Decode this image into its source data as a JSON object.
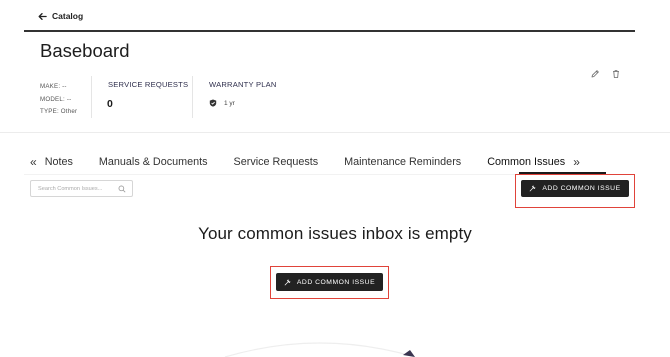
{
  "nav": {
    "back_label": "Catalog"
  },
  "asset": {
    "title": "Baseboard",
    "make": "MAKE: --",
    "model": "MODEL: --",
    "type": "TYPE: Other"
  },
  "service_requests": {
    "label": "SERVICE REQUESTS",
    "count": "0"
  },
  "warranty": {
    "label": "WARRANTY PLAN",
    "value": "1 yr"
  },
  "tabs": {
    "items": [
      {
        "label": "Notes"
      },
      {
        "label": "Manuals & Documents"
      },
      {
        "label": "Service Requests"
      },
      {
        "label": "Maintenance Reminders"
      },
      {
        "label": "Common Issues"
      }
    ],
    "active": "Common Issues"
  },
  "search": {
    "placeholder": "Search Common Issues..."
  },
  "actions": {
    "add_label": "ADD COMMON ISSUE"
  },
  "empty_state": {
    "message": "Your common issues inbox is empty",
    "button_label": "ADD COMMON ISSUE"
  },
  "colors": {
    "primary": "#222222",
    "highlight": "#e0433a"
  },
  "icons": [
    "arrow-left-icon",
    "pencil-icon",
    "trash-icon",
    "shield-check-icon",
    "chevrons-left-icon",
    "chevrons-right-icon",
    "search-icon",
    "wrench-icon"
  ]
}
